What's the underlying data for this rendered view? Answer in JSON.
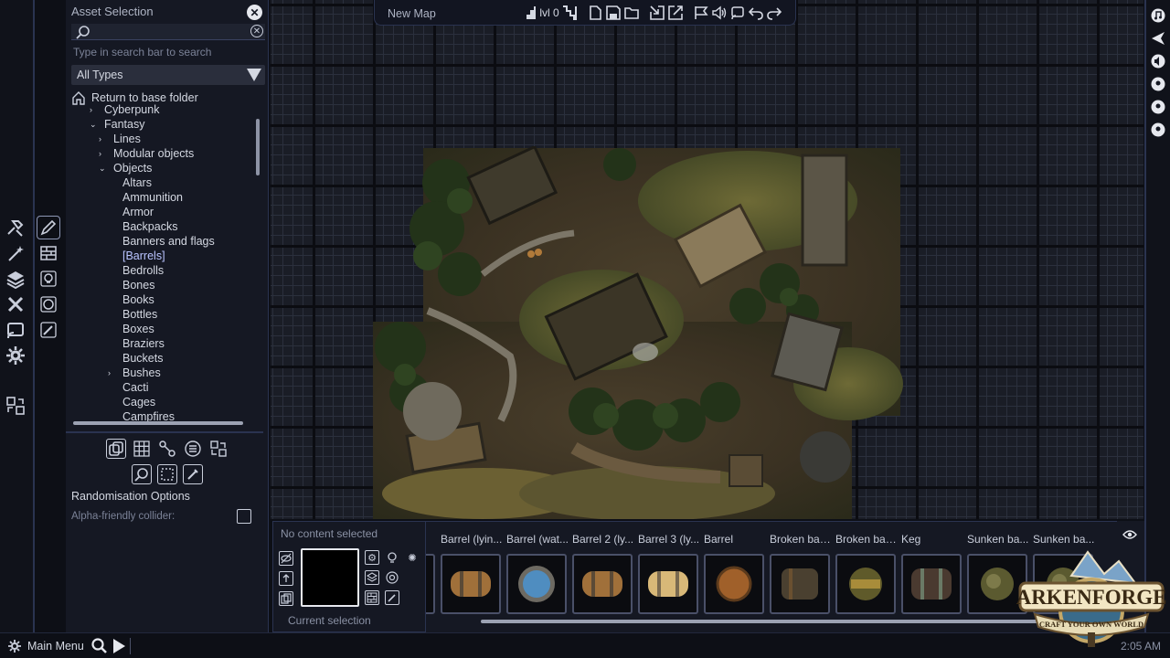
{
  "asset_panel": {
    "title": "Asset Selection",
    "search_placeholder": "Type in search bar to search",
    "type_filter": "All Types",
    "return_label": "Return to base folder",
    "tree": [
      {
        "label": "Cyberpunk",
        "caret": "›",
        "level": 1
      },
      {
        "label": "Fantasy",
        "caret": "⌄",
        "level": 1
      },
      {
        "label": "Lines",
        "caret": "›",
        "level": 2
      },
      {
        "label": "Modular objects",
        "caret": "›",
        "level": 2
      },
      {
        "label": "Objects",
        "caret": "⌄",
        "level": 2
      },
      {
        "label": "Altars",
        "caret": "",
        "level": 3
      },
      {
        "label": "Ammunition",
        "caret": "",
        "level": 3
      },
      {
        "label": "Armor",
        "caret": "",
        "level": 3
      },
      {
        "label": "Backpacks",
        "caret": "",
        "level": 3
      },
      {
        "label": "Banners and flags",
        "caret": "",
        "level": 3
      },
      {
        "label": "[Barrels]",
        "caret": "",
        "level": 3,
        "selected": true
      },
      {
        "label": "Bedrolls",
        "caret": "",
        "level": 3
      },
      {
        "label": "Bones",
        "caret": "",
        "level": 3
      },
      {
        "label": "Books",
        "caret": "",
        "level": 3
      },
      {
        "label": "Bottles",
        "caret": "",
        "level": 3
      },
      {
        "label": "Boxes",
        "caret": "",
        "level": 3
      },
      {
        "label": "Braziers",
        "caret": "",
        "level": 3
      },
      {
        "label": "Buckets",
        "caret": "",
        "level": 3
      },
      {
        "label": "Bushes",
        "caret": "›",
        "level": 3
      },
      {
        "label": "Cacti",
        "caret": "",
        "level": 3
      },
      {
        "label": "Cages",
        "caret": "",
        "level": 3
      },
      {
        "label": "Campfires",
        "caret": "",
        "level": 3
      }
    ],
    "randomisation_label": "Randomisation Options",
    "alpha_label": "Alpha-friendly collider:"
  },
  "topbar": {
    "map_name": "New Map",
    "level_label": "lvl 0"
  },
  "content_panel": {
    "title": "No content selected",
    "current_label": "Current selection"
  },
  "assets": [
    {
      "label": "Barrel (lyin...",
      "kind": "barrel-side"
    },
    {
      "label": "Barrel (wat...",
      "kind": "barrel-water"
    },
    {
      "label": "Barrel 2 (ly...",
      "kind": "barrel-side"
    },
    {
      "label": "Barrel 3 (ly...",
      "kind": "barrel-light"
    },
    {
      "label": "Barrel",
      "kind": "barrel-top"
    },
    {
      "label": "Broken bar...",
      "kind": "barrel-broken"
    },
    {
      "label": "Broken bar...",
      "kind": "barrel-broken2"
    },
    {
      "label": "Keg",
      "kind": "keg"
    },
    {
      "label": "Sunken ba...",
      "kind": "sunken"
    },
    {
      "label": "Sunken ba...",
      "kind": "sunken"
    }
  ],
  "bottombar": {
    "main_menu": "Main Menu",
    "time": "2:05 AM"
  },
  "logo": {
    "name": "ARKENFORGE",
    "tagline": "CRAFT YOUR OWN WORLD"
  },
  "colors": {
    "accent_outline": "#2a3350",
    "panel": "#151823",
    "selected_item": "#b9c4ff"
  }
}
